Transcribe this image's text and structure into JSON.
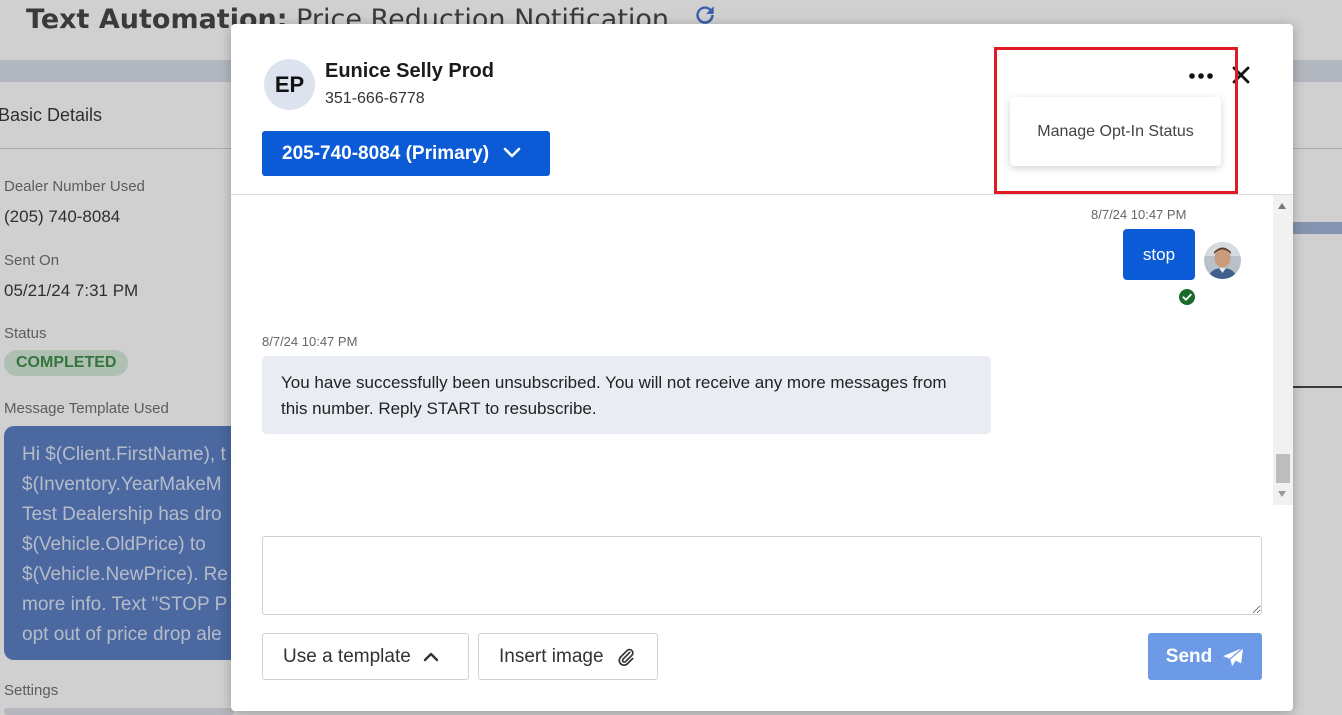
{
  "background": {
    "title_bold": "Text Automation:",
    "title_rest": " Price Reduction Notification",
    "section": "Basic Details",
    "dealer_number_label": "Dealer Number Used",
    "dealer_number_value": "(205) 740-8084",
    "sent_on_label": "Sent On",
    "sent_on_value": "05/21/24 7:31 PM",
    "status_label": "Status",
    "status_value": "COMPLETED",
    "template_label": "Message Template Used",
    "template_lines": [
      "Hi $(Client.FirstName), t",
      "$(Inventory.YearMakeM",
      "Test Dealership has dro",
      "$(Vehicle.OldPrice) to",
      "$(Vehicle.NewPrice). Re",
      "more info. Text \"STOP P",
      "opt out of price drop ale"
    ],
    "settings_label": "Settings"
  },
  "modal": {
    "avatar_initials": "EP",
    "contact_name": "Eunice Selly Prod",
    "contact_phone": "351-666-6778",
    "number_select": "205-740-8084 (Primary)",
    "dropdown_item": "Manage Opt-In Status",
    "messages": {
      "outgoing_timestamp": "8/7/24 10:47 PM",
      "outgoing_text": "stop",
      "incoming_timestamp": "8/7/24 10:47 PM",
      "incoming_text": "You have successfully been unsubscribed. You will not receive any more messages from this number. Reply START to resubscribe."
    },
    "composer": {
      "placeholder": "",
      "template_button": "Use a template",
      "image_button": "Insert image",
      "send_button": "Send"
    }
  },
  "colors": {
    "primary": "#0b5ad6",
    "send_disabled": "#6c9ae6",
    "highlight": "#e01b24",
    "status_green": "#1a7a2a"
  },
  "icons": [
    "refresh-icon",
    "chevron-down-icon",
    "more-icon",
    "close-icon",
    "check-circle-icon",
    "chevron-up-icon",
    "paperclip-icon",
    "send-icon"
  ]
}
